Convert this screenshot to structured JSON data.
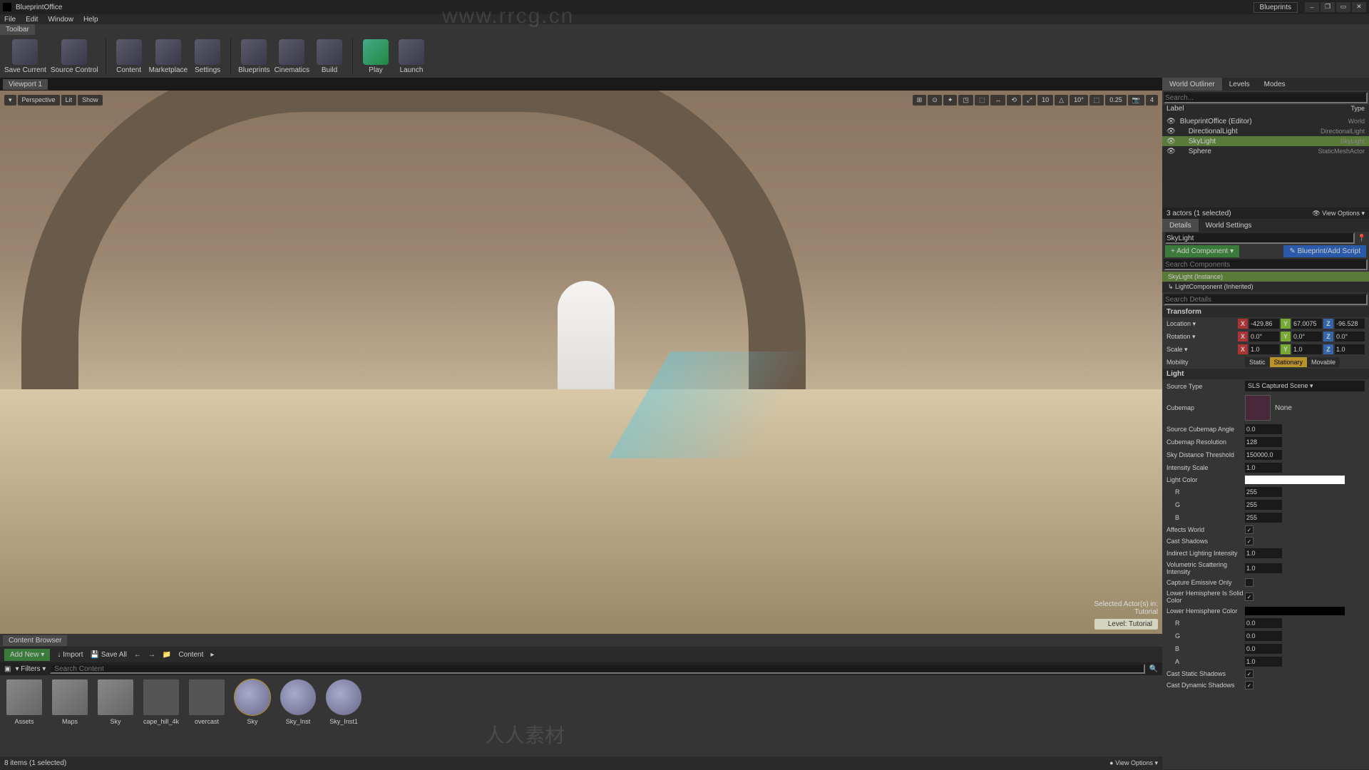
{
  "titlebar": {
    "project": "BlueprintOffice",
    "badge": "Blueprints"
  },
  "window_controls": {
    "min": "–",
    "max": "▭",
    "restore": "❐",
    "close": "✕"
  },
  "menubar": [
    "File",
    "Edit",
    "Window",
    "Help"
  ],
  "toolbar_tab": "Toolbar",
  "toolbar": [
    {
      "label": "Save Current"
    },
    {
      "label": "Source Control"
    },
    {
      "sep": true
    },
    {
      "label": "Content"
    },
    {
      "label": "Marketplace"
    },
    {
      "label": "Settings"
    },
    {
      "sep": true
    },
    {
      "label": "Blueprints"
    },
    {
      "label": "Cinematics"
    },
    {
      "label": "Build"
    },
    {
      "sep": true
    },
    {
      "label": "Play",
      "play": true
    },
    {
      "label": "Launch"
    }
  ],
  "viewport": {
    "tab": "Viewport 1",
    "left_btns": [
      "▾",
      "Perspective",
      "Lit",
      "Show"
    ],
    "right_btns": [
      "⊞",
      "⊙",
      "✦",
      "◳",
      "⬚",
      "↔",
      "⟲",
      "⤢",
      "10",
      "△",
      "10°",
      "⬚",
      "0.25",
      "📷",
      "4"
    ],
    "overlay_text": "Selected Actor(s) in:\nTutorial",
    "level_label": "Level: Tutorial"
  },
  "content_browser": {
    "tab": "Content Browser",
    "add_new": "Add New ▾",
    "import": "↓ Import",
    "save_all": "💾 Save All",
    "breadcrumb": "Content",
    "filters_label": "▾ Filters ▾",
    "search_placeholder": "Search Content",
    "assets": [
      {
        "name": "Assets",
        "type": "folder"
      },
      {
        "name": "Maps",
        "type": "folder"
      },
      {
        "name": "Sky",
        "type": "folder"
      },
      {
        "name": "cape_hill_4k",
        "type": "img"
      },
      {
        "name": "overcast",
        "type": "img"
      },
      {
        "name": "Sky",
        "type": "mat",
        "sel": true
      },
      {
        "name": "Sky_Inst",
        "type": "mat"
      },
      {
        "name": "Sky_Inst1",
        "type": "mat"
      }
    ],
    "status": "8 items (1 selected)",
    "view_options": "● View Options ▾"
  },
  "outliner": {
    "tabs": [
      {
        "label": "World Outliner",
        "active": true
      },
      {
        "label": "Levels"
      },
      {
        "label": "Modes"
      }
    ],
    "search_placeholder": "Search...",
    "cols": {
      "label": "Label",
      "type": "Type"
    },
    "rows": [
      {
        "label": "BlueprintOffice (Editor)",
        "type": "World",
        "indent": 0
      },
      {
        "label": "DirectionalLight",
        "type": "DirectionalLight",
        "indent": 1
      },
      {
        "label": "SkyLight",
        "type": "SkyLight",
        "indent": 1,
        "sel": true
      },
      {
        "label": "Sphere",
        "type": "StaticMeshActor",
        "indent": 1
      }
    ],
    "status": "3 actors (1 selected)",
    "view_options": "👁 View Options ▾"
  },
  "details": {
    "tabs": [
      {
        "label": "Details",
        "active": true
      },
      {
        "label": "World Settings"
      }
    ],
    "actor_name": "SkyLight",
    "add_component": "+ Add Component ▾",
    "blueprint_btn": "✎ Blueprint/Add Script",
    "search_components": "Search Components",
    "components": [
      {
        "label": "SkyLight (Instance)",
        "sel": true
      },
      {
        "label": "↳ LightComponent (Inherited)"
      }
    ],
    "search_details": "Search Details",
    "transform": {
      "header": "Transform",
      "location": {
        "label": "Location ▾",
        "x": "-429.86",
        "y": "67.0075",
        "z": "-96.528"
      },
      "rotation": {
        "label": "Rotation ▾",
        "x": "0.0°",
        "y": "0.0°",
        "z": "0.0°"
      },
      "scale": {
        "label": "Scale ▾",
        "x": "1.0",
        "y": "1.0",
        "z": "1.0"
      },
      "mobility": {
        "label": "Mobility",
        "options": [
          "Static",
          "Stationary",
          "Movable"
        ],
        "selected": "Stationary"
      }
    },
    "light": {
      "header": "Light",
      "source_type": {
        "label": "Source Type",
        "value": "SLS Captured Scene ▾"
      },
      "cubemap": {
        "label": "Cubemap",
        "value": "None"
      },
      "source_cubemap_angle": {
        "label": "Source Cubemap Angle",
        "value": "0.0"
      },
      "cubemap_resolution": {
        "label": "Cubemap Resolution",
        "value": "128"
      },
      "sky_distance": {
        "label": "Sky Distance Threshold",
        "value": "150000.0"
      },
      "intensity_scale": {
        "label": "Intensity Scale",
        "value": "1.0"
      },
      "light_color": {
        "label": "Light Color",
        "r": "255",
        "g": "255",
        "b": "255"
      },
      "affects_world": {
        "label": "Affects World",
        "checked": true
      },
      "cast_shadows": {
        "label": "Cast Shadows",
        "checked": true
      },
      "indirect_intensity": {
        "label": "Indirect Lighting Intensity",
        "value": "1.0"
      },
      "volumetric": {
        "label": "Volumetric Scattering Intensity",
        "value": "1.0"
      },
      "capture_emissive": {
        "label": "Capture Emissive Only",
        "checked": false
      },
      "lower_solid": {
        "label": "Lower Hemisphere Is Solid Color",
        "checked": true
      },
      "lower_color": {
        "label": "Lower Hemisphere Color",
        "r": "0.0",
        "g": "0.0",
        "b": "0.0",
        "a": "1.0"
      },
      "cast_static": {
        "label": "Cast Static Shadows",
        "checked": true
      },
      "cast_dynamic": {
        "label": "Cast Dynamic Shadows",
        "checked": true
      }
    }
  },
  "watermark_url": "www.rrcg.cn",
  "watermark_text": "人人素材"
}
